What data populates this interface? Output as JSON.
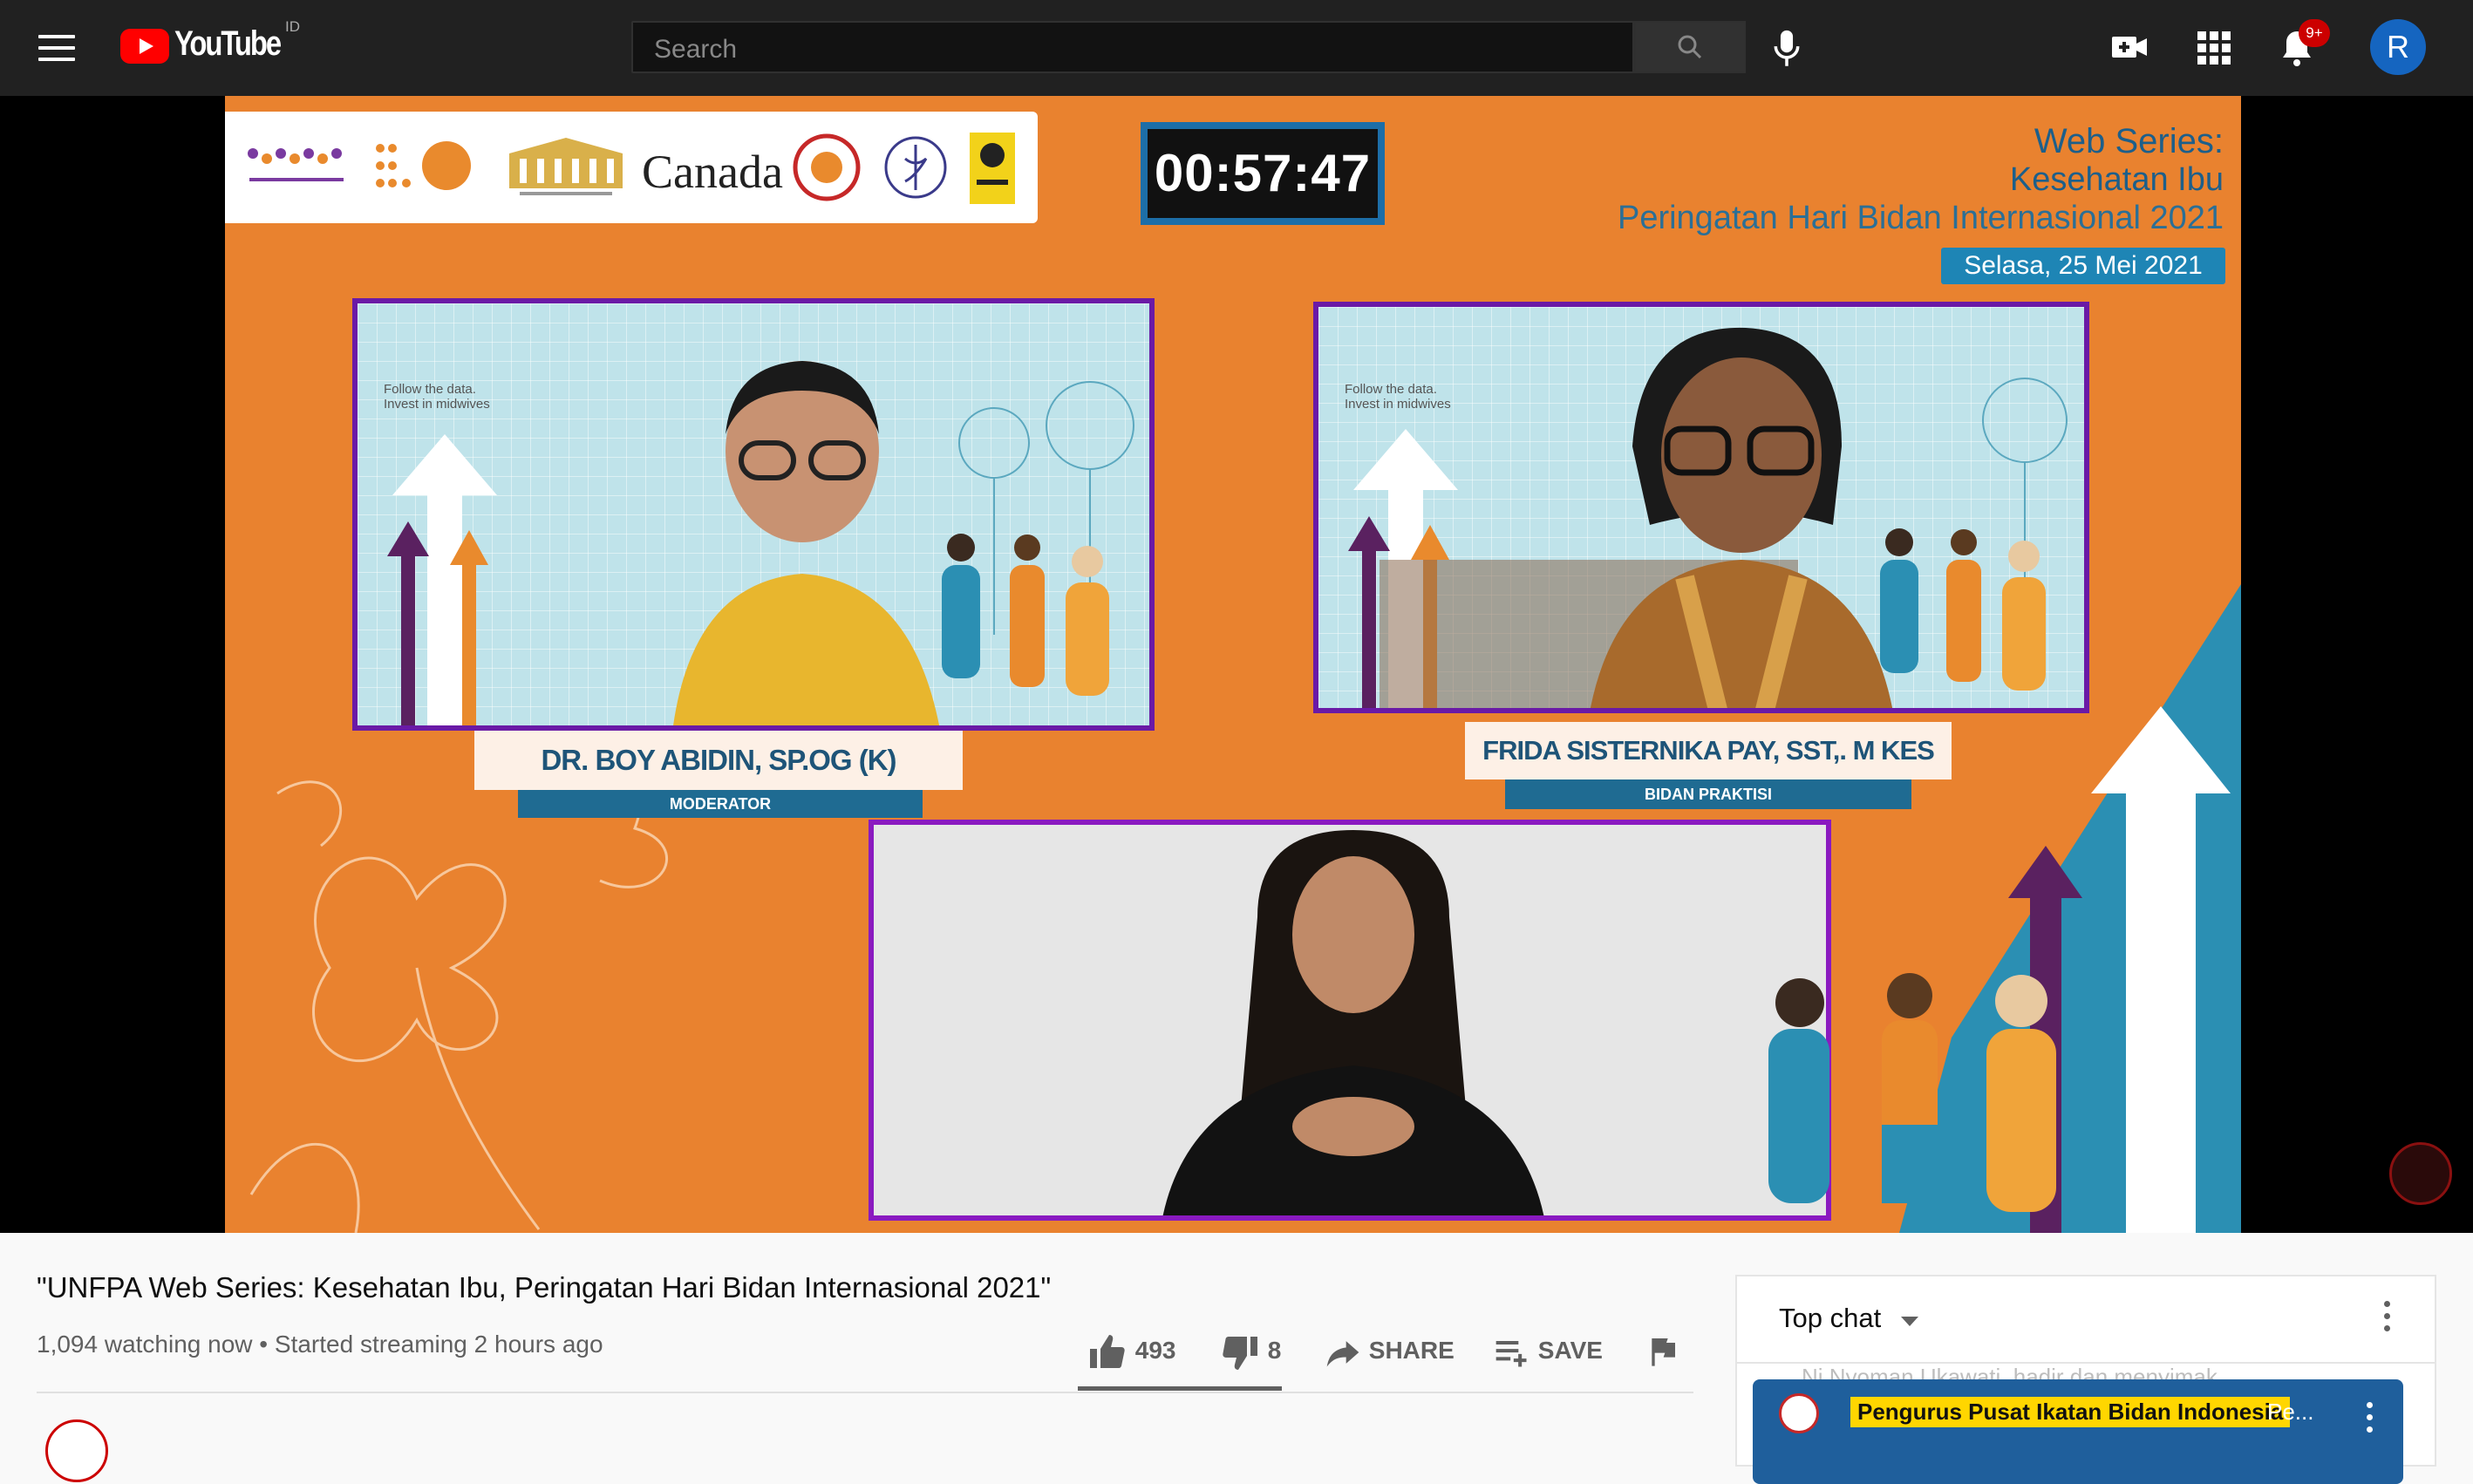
{
  "header": {
    "logo_text": "YouTube",
    "country_code": "ID",
    "search_placeholder": "Search",
    "notification_count": "9+",
    "avatar_letter": "R"
  },
  "video": {
    "logo_strip_text": "Canada",
    "countdown": "00:57:47",
    "series_title": "Web Series:",
    "series_subtitle_1": "Kesehatan Ibu",
    "series_subtitle_2": "Peringatan Hari Bidan Internasional 2021",
    "series_date": "Selasa, 25 Mei 2021",
    "panel_tagline": "Follow the data.\nInvest in midwives",
    "speakers": [
      {
        "name": "DR. BOY ABIDIN, SP.OG (K)",
        "role": "MODERATOR"
      },
      {
        "name": "FRIDA SISTERNIKA PAY, SST,. M KES",
        "role": "BIDAN PRAKTISI"
      }
    ]
  },
  "info": {
    "title": "\"UNFPA Web Series: Kesehatan Ibu, Peringatan Hari Bidan Internasional 2021\"",
    "viewers": "1,094 watching now",
    "separator": "•",
    "started": "Started streaming 2 hours ago",
    "likes": "493",
    "dislikes": "8",
    "share_label": "SHARE",
    "save_label": "SAVE"
  },
  "chat": {
    "mode_label": "Top chat",
    "ghost_message": "Ni Nyoman Ukawati, hadir dan menyimak",
    "pinned_author": "Pengurus Pusat Ikatan Bidan Indonesia",
    "pinned_text": "Pe..."
  },
  "colors": {
    "topbar": "#212121",
    "brand_red": "#ff0000",
    "video_bg": "#e9822f",
    "panel_border": "#6a1aa6",
    "accent_blue": "#1565c0"
  }
}
